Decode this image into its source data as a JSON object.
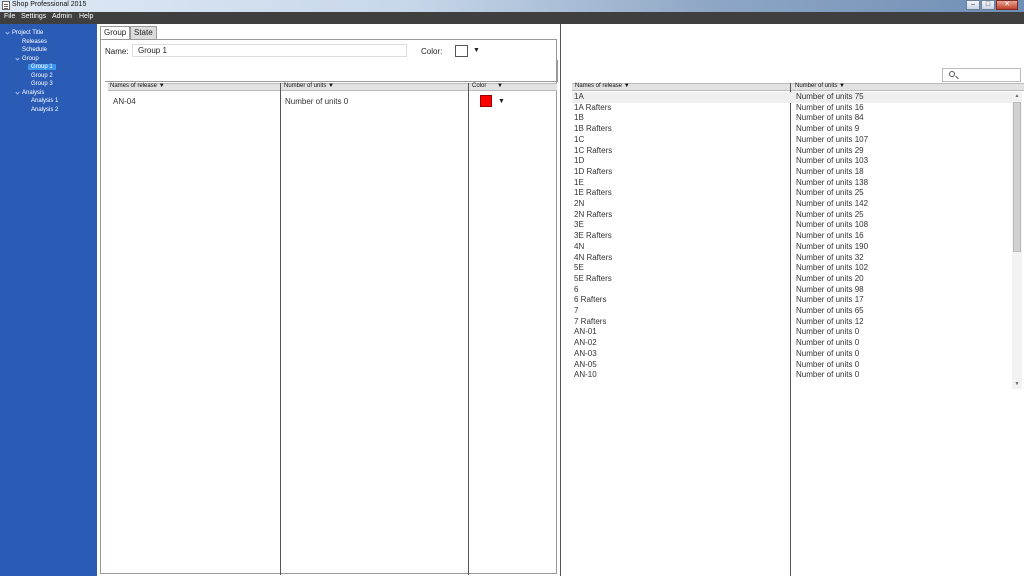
{
  "window": {
    "title": "Shop Professional 2015"
  },
  "menu": [
    "File",
    "Settings",
    "Admin",
    "Help"
  ],
  "tree": {
    "root": "Project Title",
    "items": [
      {
        "label": "Releases",
        "level": 1
      },
      {
        "label": "Schedule",
        "level": 1
      },
      {
        "label": "Group",
        "level": 1
      },
      {
        "label": "Group 1",
        "level": 2,
        "selected": true
      },
      {
        "label": "Group 2",
        "level": 2
      },
      {
        "label": "Group 3",
        "level": 2
      },
      {
        "label": "Analysis",
        "level": 1
      },
      {
        "label": "Analysis 1",
        "level": 2
      },
      {
        "label": "Analysis 2",
        "level": 2
      }
    ]
  },
  "tabs": [
    {
      "label": "Group",
      "active": true
    },
    {
      "label": "State",
      "active": false
    }
  ],
  "group_form": {
    "name_label": "Name:",
    "name_value": "Group 1",
    "color_label": "Color:"
  },
  "group_grid": {
    "headers": [
      "Names of release",
      "Number of units",
      "Color"
    ],
    "rows": [
      {
        "name": "AN-04",
        "units": "Number of units 0",
        "color": "#ff0000"
      }
    ]
  },
  "release_grid": {
    "headers": [
      "Names of release",
      "Number of units"
    ],
    "rows": [
      {
        "name": "1A",
        "units": "Number of units 75"
      },
      {
        "name": "1A Rafters",
        "units": "Number of units 16"
      },
      {
        "name": "1B",
        "units": "Number of units 84"
      },
      {
        "name": "1B Rafters",
        "units": "Number of units 9"
      },
      {
        "name": "1C",
        "units": "Number of units 107"
      },
      {
        "name": "1C Rafters",
        "units": "Number of units 29"
      },
      {
        "name": "1D",
        "units": "Number of units 103"
      },
      {
        "name": "1D Rafters",
        "units": "Number of units 18"
      },
      {
        "name": "1E",
        "units": "Number of units 138"
      },
      {
        "name": "1E Rafters",
        "units": "Number of units 25"
      },
      {
        "name": "2N",
        "units": "Number of units 142"
      },
      {
        "name": "2N Rafters",
        "units": "Number of units 25"
      },
      {
        "name": "3E",
        "units": "Number of units 108"
      },
      {
        "name": "3E Rafters",
        "units": "Number of units 16"
      },
      {
        "name": "4N",
        "units": "Number of units 190"
      },
      {
        "name": "4N Rafters",
        "units": "Number of units 32"
      },
      {
        "name": "5E",
        "units": "Number of units 102"
      },
      {
        "name": "5E Rafters",
        "units": "Number of units 20"
      },
      {
        "name": "6",
        "units": "Number of units 98"
      },
      {
        "name": "6 Rafters",
        "units": "Number of units 17"
      },
      {
        "name": "7",
        "units": "Number of units 65"
      },
      {
        "name": "7 Rafters",
        "units": "Number of units 12"
      },
      {
        "name": "AN-01",
        "units": "Number of units 0"
      },
      {
        "name": "AN-02",
        "units": "Number of units 0"
      },
      {
        "name": "AN-03",
        "units": "Number of units 0"
      },
      {
        "name": "AN-05",
        "units": "Number of units 0"
      },
      {
        "name": "AN-10",
        "units": "Number of units 0"
      }
    ]
  },
  "colors": {
    "sidebar": "#2a5bb5",
    "selected_tree": "#3d95f0",
    "menubar": "#3f3f3f"
  }
}
